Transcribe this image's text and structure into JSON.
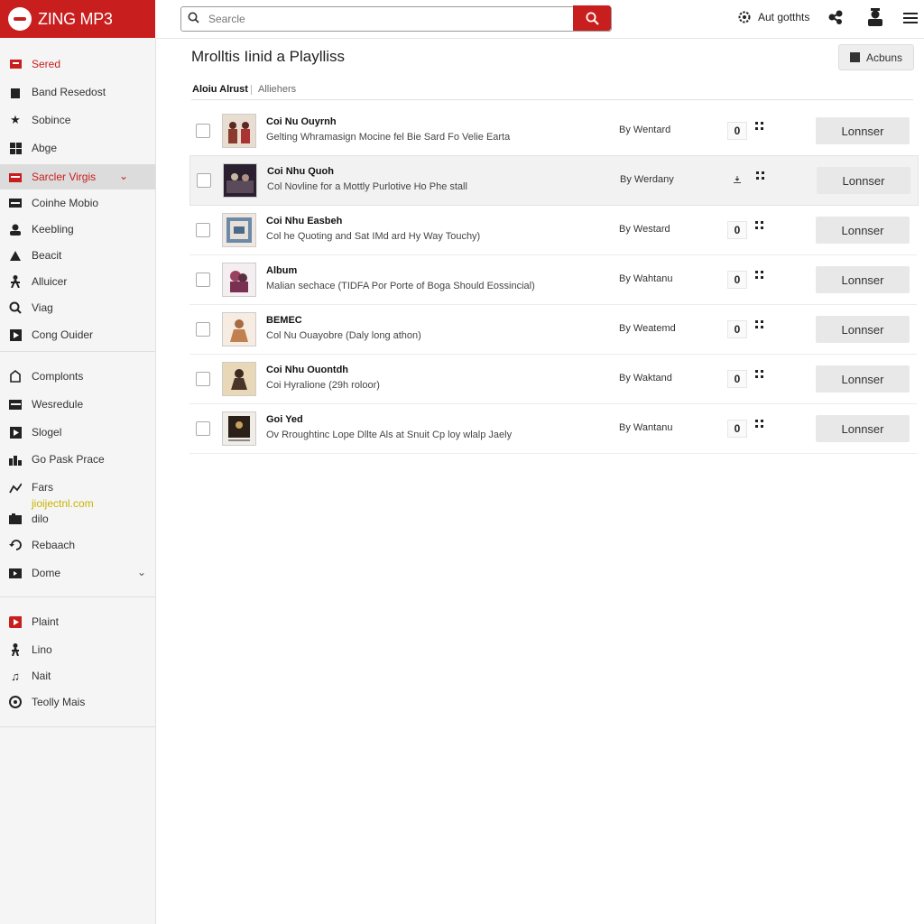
{
  "app": {
    "logo_text": "ZING MP3"
  },
  "search": {
    "placeholder": "Searcle"
  },
  "topbar": {
    "account_label": "Aut gotthts"
  },
  "sidebar": {
    "items": [
      {
        "label": "Sered",
        "icon": "playlist-icon"
      },
      {
        "label": "Band Resedost",
        "icon": "building-icon"
      },
      {
        "label": "Sobince",
        "icon": "star-icon"
      },
      {
        "label": "Abge",
        "icon": "grid-icon"
      },
      {
        "label": "Sarcler Virgis",
        "icon": "folder-icon"
      },
      {
        "label": "Coinhe Mobio",
        "icon": "list-icon"
      },
      {
        "label": "Keebling",
        "icon": "user-icon"
      },
      {
        "label": "Beacit",
        "icon": "compass-icon"
      },
      {
        "label": "Alluicer",
        "icon": "person-icon"
      },
      {
        "label": "Viag",
        "icon": "search-icon"
      },
      {
        "label": "Cong Ouider",
        "icon": "play-icon"
      }
    ],
    "items2": [
      {
        "label": "Complonts",
        "icon": "document-icon"
      },
      {
        "label": "Wesredule",
        "icon": "calendar-icon"
      },
      {
        "label": "Slogel",
        "icon": "play-icon"
      },
      {
        "label": "Go Pask Prace",
        "icon": "chart-icon"
      },
      {
        "label": "Fars",
        "icon": "trend-icon"
      },
      {
        "label": "dilo",
        "icon": "film-icon"
      },
      {
        "label": "Rebaach",
        "icon": "refresh-icon"
      },
      {
        "label": "Dome",
        "icon": "home-icon"
      }
    ],
    "sub_link": "jioijectnl.com",
    "items3": [
      {
        "label": "Plaint",
        "icon": "play-icon"
      },
      {
        "label": "Lino",
        "icon": "person-icon"
      },
      {
        "label": "Nait",
        "icon": "music-note-icon"
      },
      {
        "label": "Teolly Mais",
        "icon": "disc-icon"
      }
    ]
  },
  "main": {
    "title": "Mrolltis Iinid a Playlliss",
    "albums_button": "Acbuns",
    "tabs": [
      {
        "label": "Aloiu Alrust"
      },
      {
        "label": "Alliehers"
      }
    ],
    "rows": [
      {
        "title": "Coi Nu Ouyrnh",
        "subtitle": "Gelting Whramasign Mocine fel Bie Sard Fo Velie Earta",
        "by": "By Wentard",
        "count": "0",
        "button": "Lonnser",
        "thumb_color": "#8b3a2e"
      },
      {
        "title": "Coi Nhu Quoh",
        "subtitle": "Col Novline for a Mottly Purlotive Ho Phe stall",
        "by": "By Werdany",
        "count": "",
        "button": "Lonnser",
        "thumb_color": "#3a2a36"
      },
      {
        "title": "Coi Nhu Easbeh",
        "subtitle": "Col he Quoting and Sat IMd ard Hy Way Touchy)",
        "by": "By Westard",
        "count": "0",
        "button": "Lonnser",
        "thumb_color": "#6a8aa8"
      },
      {
        "title": "Album",
        "subtitle": "Malian sechace (TIDFA Por Porte of Boga Should Eossincial)",
        "by": "By Wahtanu",
        "count": "0",
        "button": "Lonnser",
        "thumb_color": "#9a4060"
      },
      {
        "title": "BEMEC",
        "subtitle": "Col Nu Ouayobre (Daly long athon)",
        "by": "By Weatemd",
        "count": "0",
        "button": "Lonnser",
        "thumb_color": "#c08050"
      },
      {
        "title": "Coi Nhu Ouontdh",
        "subtitle": "Coi Hyralione (29h roloor)",
        "by": "By Waktand",
        "count": "0",
        "button": "Lonnser",
        "thumb_color": "#c0a070"
      },
      {
        "title": "Goi Yed",
        "subtitle": "Ov Rroughtinc Lope Dllte Als at Snuit Cp loy wlalp Jaely",
        "by": "By Wantanu",
        "count": "0",
        "button": "Lonnser",
        "thumb_color": "#3a2e22"
      }
    ]
  }
}
